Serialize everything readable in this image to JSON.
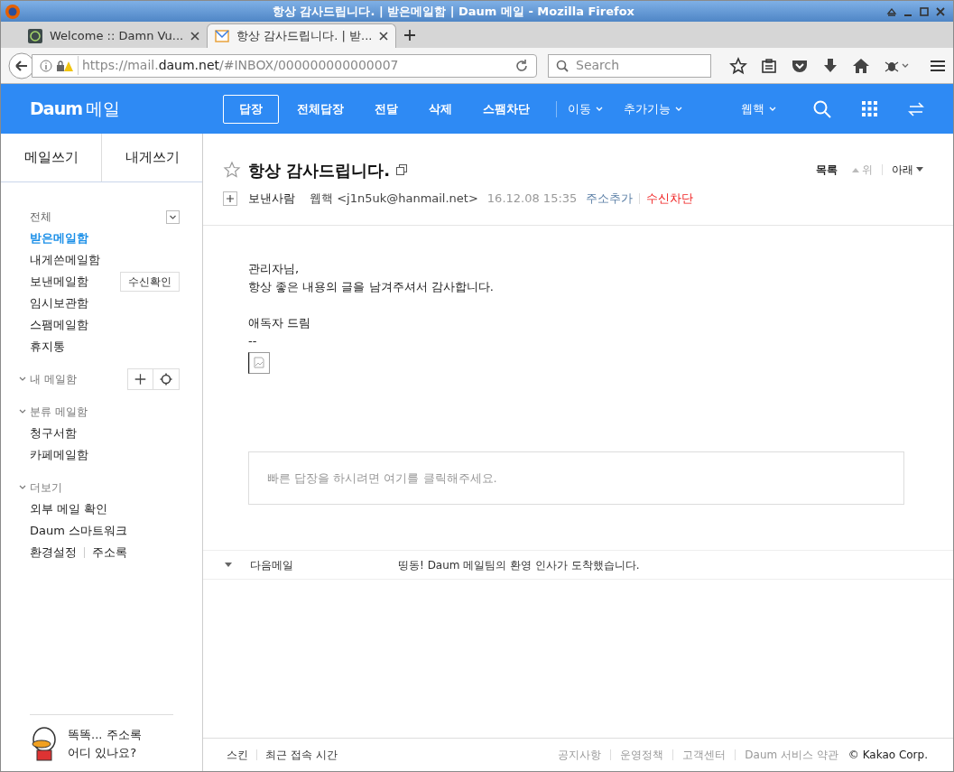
{
  "window": {
    "title": "항상 감사드립니다. | 받은메일함 | Daum 메일 - Mozilla Firefox"
  },
  "tabs": [
    {
      "label": "Welcome :: Damn Vu...",
      "selected": false
    },
    {
      "label": "항상 감사드립니다. | 받...",
      "selected": true
    }
  ],
  "address_bar": {
    "url_start": "https://mail.",
    "url_domain": "daum.net",
    "url_end": "/#INBOX/000000000000007"
  },
  "search": {
    "placeholder": "Search"
  },
  "header": {
    "logo": "Daum",
    "service": "메일",
    "actions": [
      {
        "label": "답장",
        "kind": "primary"
      },
      {
        "label": "전체답장",
        "kind": "plain"
      },
      {
        "label": "전달",
        "kind": "plain"
      },
      {
        "label": "삭제",
        "kind": "plain"
      },
      {
        "label": "스팸차단",
        "kind": "plain"
      },
      {
        "label": "이동",
        "kind": "dropdown"
      },
      {
        "label": "추가기능",
        "kind": "dropdown"
      }
    ],
    "user": "웹핵"
  },
  "sidebar": {
    "compose": [
      "메일쓰기",
      "내게쓰기"
    ],
    "all_label": "전체",
    "folders": [
      {
        "label": "받은메일함",
        "selected": true
      },
      {
        "label": "내게쓴메일함",
        "selected": false
      },
      {
        "label": "보낸메일함",
        "selected": false,
        "button": "수신확인"
      },
      {
        "label": "임시보관함",
        "selected": false
      },
      {
        "label": "스팸메일함",
        "selected": false
      },
      {
        "label": "휴지통",
        "selected": false
      }
    ],
    "sections": [
      {
        "title": "내 메일함",
        "expanded": true,
        "tools": true
      },
      {
        "title": "분류 메일함",
        "expanded": true,
        "items": [
          "청구서함",
          "카페메일함"
        ]
      },
      {
        "title": "더보기",
        "expanded": true,
        "items": [
          "외부 메일 확인",
          "Daum 스마트워크"
        ]
      }
    ],
    "settings_links": [
      "환경설정",
      "주소록"
    ],
    "promo": [
      "똑똑... 주소록",
      "어디 있나요?"
    ]
  },
  "message": {
    "subject": "항상 감사드립니다.",
    "starred": false,
    "nav": [
      {
        "label": "목록",
        "enabled": true
      },
      {
        "label": "위",
        "enabled": false
      },
      {
        "label": "아래",
        "enabled": true
      }
    ],
    "from_label": "보낸사람",
    "sender": "웹핵 <j1n5uk@hanmail.net>",
    "date": "16.12.08 15:35",
    "sender_actions": [
      {
        "label": "주소추가",
        "kind": "link"
      },
      {
        "label": "수신차단",
        "kind": "danger"
      }
    ],
    "body": [
      [
        "관리자님,",
        "항상 좋은 내용의 글을 남겨주셔서 감사합니다."
      ],
      [
        "애독자 드림",
        "--"
      ]
    ],
    "quick_reply": {
      "placeholder": "빠른 답장을 하시려면 여기를 클릭해주세요."
    },
    "next_mail": {
      "label": "다음메일",
      "subject": "띵동! Daum 메일팀의 환영 인사가 도착했습니다."
    }
  },
  "footer": {
    "left": [
      "스킨",
      "최근 접속 시간"
    ],
    "right": [
      "공지사항",
      "운영정책",
      "고객센터",
      "Daum 서비스 약관"
    ],
    "copyright": "© Kakao Corp."
  }
}
